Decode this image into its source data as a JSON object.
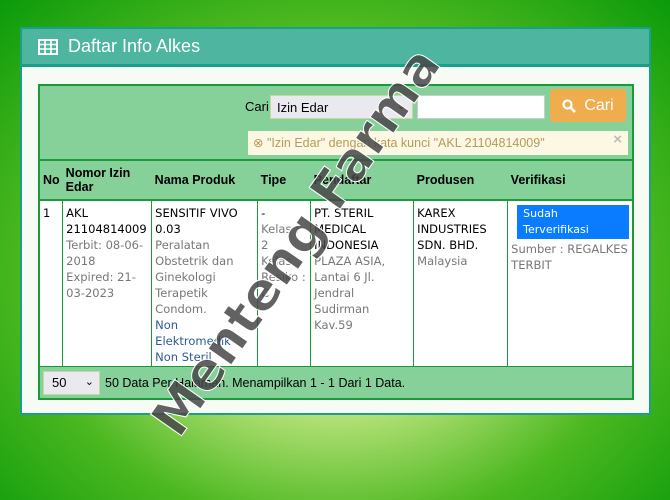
{
  "header": {
    "title": "Daftar Info Alkes"
  },
  "search": {
    "label": "Cari",
    "select_value": "Izin Edar",
    "input_value": "",
    "button_label": "Cari",
    "alert": "\"Izin Edar\" dengan kata kunci \"AKL 21104814009\""
  },
  "table": {
    "columns": [
      "No",
      "Nomor Izin Edar",
      "Nama Produk",
      "Tipe",
      "Pendaftar",
      "Produsen",
      "Verifikasi"
    ],
    "rows": [
      {
        "no": "1",
        "nomor": "AKL 21104814009",
        "terbit": "Terbit: 08-06-2018",
        "expired": "Expired: 21-03-2023",
        "nama": "SENSITIF VIVO 0.03",
        "kategori": "Peralatan Obstetrik dan Ginekologi Terapetik Condom.",
        "jenis1": "Non Elektromedik",
        "jenis2": "Non Steril",
        "tipe": "-",
        "kelas": "Kelas : 2",
        "resiko": "Kelas Resiko : C",
        "pendaftar": "PT. STERIL MEDICAL INDONESIA",
        "alamat": "PLAZA ASIA, Lantai 6 Jl. Jendral Sudirman Kav.59",
        "produsen": "KAREX INDUSTRIES SDN. BHD.",
        "negara": "Malaysia",
        "status": "Sudah Terverifikasi",
        "sumber": "Sumber : REGALKES TERBIT"
      }
    ]
  },
  "footer": {
    "per_page": "50",
    "info": "50 Data Per Halaman. Menampilkan 1 - 1 Dari 1 Data."
  },
  "watermark": "Menteng Farma",
  "colors": {
    "header": "#4db5a0",
    "table_green": "#86d09a",
    "button": "#f0ad4e",
    "badge": "#0a7cff"
  }
}
